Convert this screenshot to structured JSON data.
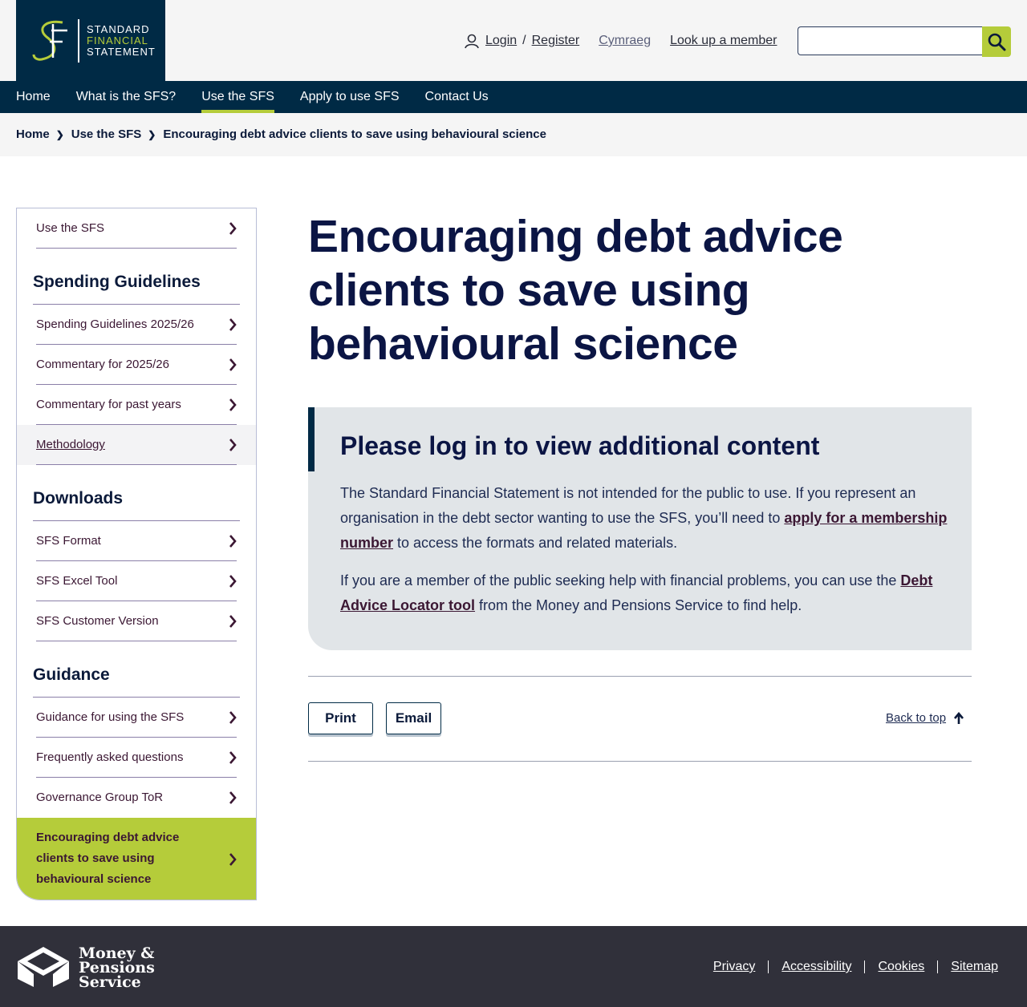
{
  "header": {
    "logo_lines": [
      "STANDARD",
      "FINANCIAL",
      "STATEMENT"
    ],
    "login": "Login",
    "separator": "/",
    "register": "Register",
    "language": "Cymraeg",
    "lookup": "Look up a member",
    "search_placeholder": ""
  },
  "nav": [
    {
      "label": "Home"
    },
    {
      "label": "What is the SFS?"
    },
    {
      "label": "Use the SFS",
      "active": true
    },
    {
      "label": "Apply to use SFS"
    },
    {
      "label": "Contact Us"
    }
  ],
  "breadcrumb": [
    "Home",
    "Use the SFS",
    "Encouraging debt advice clients to save using behavioural science"
  ],
  "sidebar": {
    "top_item": "Use the SFS",
    "sections": [
      {
        "heading": "Spending Guidelines",
        "items": [
          "Spending Guidelines 2025/26",
          "Commentary for 2025/26",
          "Commentary for past years",
          "Methodology"
        ]
      },
      {
        "heading": "Downloads",
        "items": [
          "SFS Format",
          "SFS Excel Tool",
          "SFS Customer Version"
        ]
      },
      {
        "heading": "Guidance",
        "items": [
          "Guidance for using the SFS",
          "Frequently asked questions",
          "Governance Group ToR"
        ]
      }
    ],
    "current_item": "Encouraging debt advice clients to save using behavioural science"
  },
  "main": {
    "title": "Encouraging debt advice clients to save using behavioural science",
    "notice": {
      "heading": "Please log in to view additional content",
      "p1_before": "The Standard Financial Statement is not intended for the public to use. If you represent an organisation in the debt sector wanting to use the SFS, you’ll need to ",
      "p1_link": "apply for a membership number",
      "p1_after": " to access the formats and related materials.",
      "p2_before": "If you are a member of the public seeking help with financial problems, you can use the ",
      "p2_link": "Debt Advice Locator tool",
      "p2_after": " from the Money and Pensions Service to find help."
    },
    "print_label": "Print",
    "email_label": "Email",
    "back_to_top": "Back to top"
  },
  "footer": {
    "org_lines": [
      "Money &",
      "Pensions",
      "Service"
    ],
    "links": [
      "Privacy",
      "Accessibility",
      "Cookies",
      "Sitemap"
    ]
  },
  "colors": {
    "navy": "#002a45",
    "lime": "#b5cc3a",
    "plum": "#3b1733",
    "footer": "#30303a"
  }
}
